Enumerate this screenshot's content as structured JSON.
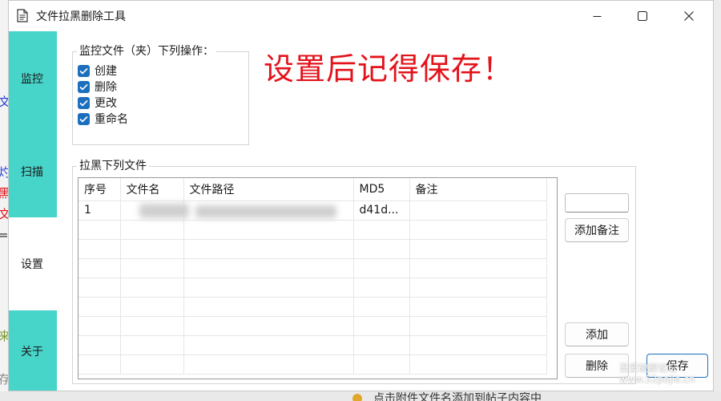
{
  "window": {
    "title": "文件拉黑删除工具"
  },
  "sidebar": {
    "tabs": [
      {
        "label": "监控"
      },
      {
        "label": "扫描"
      },
      {
        "label": "设置"
      },
      {
        "label": "关于"
      }
    ]
  },
  "monitor_group": {
    "title": "监控文件（夹）下列操作：",
    "options": [
      {
        "label": "创建",
        "checked": true
      },
      {
        "label": "删除",
        "checked": true
      },
      {
        "label": "更改",
        "checked": true
      },
      {
        "label": "重命名",
        "checked": true
      }
    ]
  },
  "reminder": "设置后记得保存！",
  "blacklist_group": {
    "title": "拉黑下列文件",
    "columns": [
      "序号",
      "文件名",
      "文件路径",
      "MD5",
      "备注"
    ],
    "rows": [
      {
        "index": "1",
        "md5": "d41d..."
      }
    ]
  },
  "buttons": {
    "add_note": "添加备注",
    "add": "添加",
    "delete": "删除",
    "save": "保存"
  },
  "background": {
    "left_glyphs": [
      "文",
      "灼",
      "黑",
      "文",
      "=",
      "来",
      "存"
    ],
    "bottom_text": "点击附件文件名添加到帖子内容中"
  },
  "watermark": {
    "line1": "吾爱破解论坛",
    "line2": "www.52pojie.cn"
  },
  "colors": {
    "tab_accent": "#47d4c9",
    "reminder": "#e3131b",
    "checkbox": "#1c6fbd"
  }
}
